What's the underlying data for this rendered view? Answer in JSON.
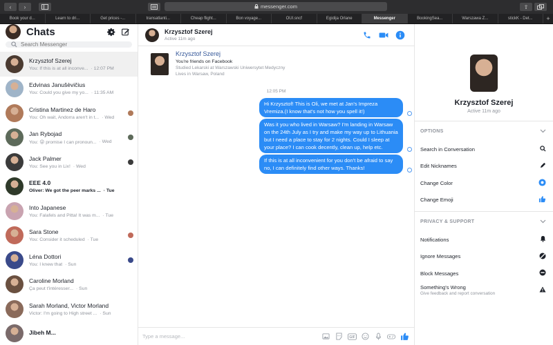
{
  "browser": {
    "url": "messenger.com",
    "tabs": [
      {
        "label": "Book your d...",
        "active": false
      },
      {
        "label": "Learn to dri...",
        "active": false
      },
      {
        "label": "Get prices -...",
        "active": false
      },
      {
        "label": "transatlanti...",
        "active": false
      },
      {
        "label": "Cheap flight...",
        "active": false
      },
      {
        "label": "Bon voyage...",
        "active": false
      },
      {
        "label": "OUI.sncf",
        "active": false
      },
      {
        "label": "Egidija Orlane",
        "active": false
      },
      {
        "label": "Messenger",
        "active": true
      },
      {
        "label": "BookingSea...",
        "active": false
      },
      {
        "label": "Warszawa Z...",
        "active": false
      },
      {
        "label": "stickK - Det...",
        "active": false
      }
    ],
    "new_tab": "+"
  },
  "sidebar": {
    "title": "Chats",
    "search_placeholder": "Search Messenger",
    "conversations": [
      {
        "name": "Krzysztof Szerej",
        "snippet": "You: If this is at all inconve...",
        "time": "· 12:07 PM",
        "bold": false,
        "active": true,
        "avatar_color": "#4a3a30",
        "seen": false
      },
      {
        "name": "Edvinas Janušèvičius",
        "snippet": "You: Could you give my yo...",
        "time": "· 11:35 AM",
        "bold": false,
        "active": false,
        "avatar_color": "#9fb4c8",
        "seen": false
      },
      {
        "name": "Cristina Martinez de Haro",
        "snippet": "You: Oh wait, Andorra aren't in t...",
        "time": "· Wed",
        "bold": false,
        "active": false,
        "avatar_color": "#b07a5a",
        "seen": true
      },
      {
        "name": "Jan Rybojad",
        "snippet": "You: 😜 promise I can pronoun...",
        "time": "· Wed",
        "bold": false,
        "active": false,
        "avatar_color": "#5d6a5a",
        "seen": true
      },
      {
        "name": "Jack Palmer",
        "snippet": "You: See you in Lix!",
        "time": "· Wed",
        "bold": false,
        "active": false,
        "avatar_color": "#3b3b3b",
        "seen": true
      },
      {
        "name": "EEE 4.0",
        "snippet": "Oliver: We got the peer marks ...",
        "time": "· Tue",
        "bold": true,
        "active": false,
        "avatar_color": "#2f3a2a",
        "seen": false
      },
      {
        "name": "Into Japanese",
        "snippet": "You: Falafels and Pitta! It was m...",
        "time": "· Tue",
        "bold": false,
        "active": false,
        "avatar_color": "#c9a3b0",
        "seen": false
      },
      {
        "name": "Sara Stone",
        "snippet": "You: Consider it scheduled",
        "time": "· Tue",
        "bold": false,
        "active": false,
        "avatar_color": "#c06a5a",
        "seen": true
      },
      {
        "name": "Léna Dottori",
        "snippet": "You: I knew that",
        "time": "· Sun",
        "bold": false,
        "active": false,
        "avatar_color": "#3a4a8a",
        "seen": true
      },
      {
        "name": "Caroline Morland",
        "snippet": "Ça peut t'intéresser...",
        "time": "· Sun",
        "bold": false,
        "active": false,
        "avatar_color": "#6a5040",
        "seen": false
      },
      {
        "name": "Sarah Morland, Victor Morland",
        "snippet": "Victor: I'm going to High street ...",
        "time": "· Sun",
        "bold": false,
        "active": false,
        "avatar_color": "#8a6a5a",
        "seen": false
      },
      {
        "name": "Jibeh M...",
        "snippet": "",
        "time": "",
        "bold": true,
        "active": false,
        "avatar_color": "#7a6a6a",
        "seen": false
      }
    ]
  },
  "chat": {
    "name": "Krzysztof Szerej",
    "status": "Active 11m ago",
    "intro": {
      "name": "Krzysztof Szerej",
      "friends": "You're friends on Facebook",
      "study": "Studied Lekarski at Warszawski Uniwersytet Medyczny",
      "lives": "Lives in Warsaw, Poland"
    },
    "time_separator": "12:05 PM",
    "messages": [
      {
        "text": "Hi Krzysztof!  This is Oli, we met at Jan's Impreza Vremiza.(I know that's not how you spell it!)"
      },
      {
        "text": "Was it you who lived in Warsaw? I'm landing in Warsaw on the 24th July as I try and make my way up to Lithuania but I need a place to stay for 2 nights. Could I sleep at your place? I can cook decently, clean up, help etc."
      },
      {
        "text": "If this is at all inconvenient for you don't be afraid to say no, I can definitely find other ways. Thanks!"
      }
    ],
    "composer_placeholder": "Type a message...",
    "composer_value": ""
  },
  "info": {
    "name": "Krzysztof Szerej",
    "status": "Active 11m ago",
    "options_title": "OPTIONS",
    "options": [
      {
        "label": "Search in Conversation",
        "icon": "search-icon"
      },
      {
        "label": "Edit Nicknames",
        "icon": "pencil-icon"
      },
      {
        "label": "Change Color",
        "icon": "color-icon"
      },
      {
        "label": "Change Emoji",
        "icon": "thumbs-up-icon"
      }
    ],
    "privacy_title": "PRIVACY & SUPPORT",
    "privacy": [
      {
        "label": "Notifications",
        "sub": "",
        "icon": "bell-icon"
      },
      {
        "label": "Ignore Messages",
        "sub": "",
        "icon": "ignore-icon"
      },
      {
        "label": "Block Messages",
        "sub": "",
        "icon": "block-icon"
      },
      {
        "label": "Something's Wrong",
        "sub": "Give feedback and report conversation",
        "icon": "warning-icon"
      }
    ]
  },
  "colors": {
    "accent": "#2b8cf6",
    "muted": "#90949c",
    "link": "#365899"
  }
}
